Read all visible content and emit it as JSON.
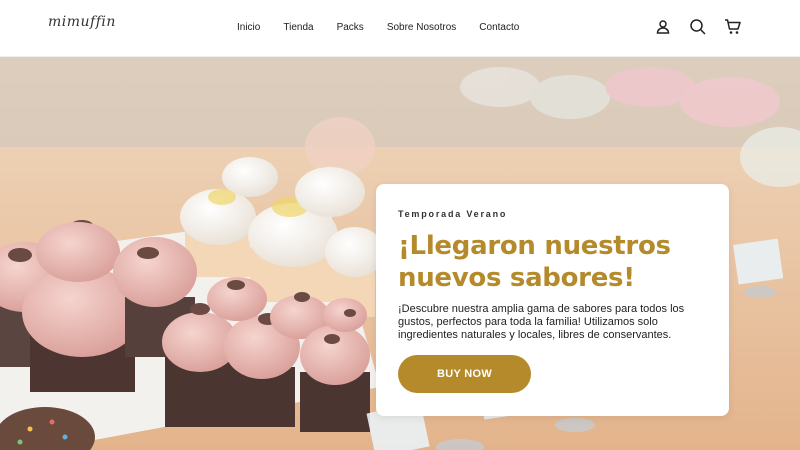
{
  "brand": {
    "logo_text": "mimuffin"
  },
  "nav": {
    "items": [
      {
        "label": "Inicio"
      },
      {
        "label": "Tienda"
      },
      {
        "label": "Packs"
      },
      {
        "label": "Sobre Nosotros"
      },
      {
        "label": "Contacto"
      }
    ],
    "icons": [
      "user-icon",
      "search-icon",
      "cart-icon"
    ]
  },
  "hero": {
    "eyebrow": "Temporada Verano",
    "headline_line1": "¡Llegaron nuestros",
    "headline_line2": "nuevos sabores!",
    "description": "¡Descubre nuestra amplia gama de sabores para todos los gustos, perfectos para toda la familia! Utilizamos solo ingredientes naturales y locales, libres de conservantes.",
    "cta_label": "BUY NOW",
    "accent_color": "#b58a2a"
  }
}
